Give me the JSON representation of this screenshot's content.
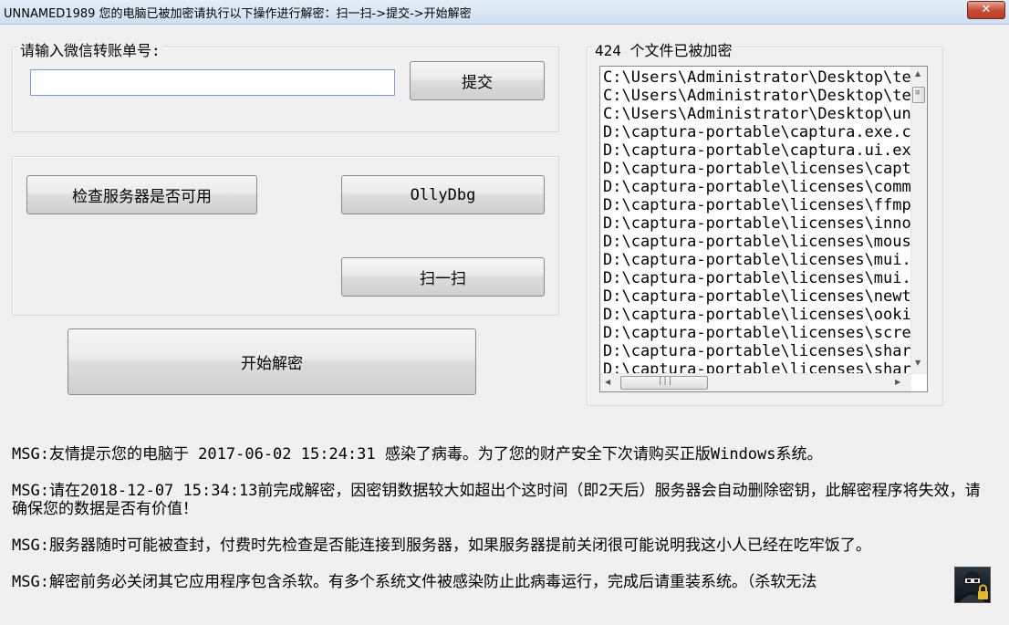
{
  "window": {
    "title": "UNNAMED1989 您的电脑已被加密请执行以下操作进行解密：扫一扫->提交->开始解密",
    "close_label": "✕"
  },
  "transfer": {
    "label": "请输入微信转账单号:",
    "input_value": "",
    "submit_label": "提交"
  },
  "actions": {
    "check_server_label": "检查服务器是否可用",
    "ollydbg_label": "OllyDbg",
    "scan_label": "扫一扫",
    "decrypt_label": "开始解密"
  },
  "files": {
    "label": "424 个文件已被加密",
    "items": [
      "C:\\Users\\Administrator\\Desktop\\te",
      "C:\\Users\\Administrator\\Desktop\\te",
      "C:\\Users\\Administrator\\Desktop\\un",
      "D:\\captura-portable\\captura.exe.co",
      "D:\\captura-portable\\captura.ui.exe",
      "D:\\captura-portable\\licenses\\captu",
      "D:\\captura-portable\\licenses\\comma",
      "D:\\captura-portable\\licenses\\ffmpe",
      "D:\\captura-portable\\licenses\\inno.",
      "D:\\captura-portable\\licenses\\mouse",
      "D:\\captura-portable\\licenses\\mui.c",
      "D:\\captura-portable\\licenses\\mui.t",
      "D:\\captura-portable\\licenses\\newto",
      "D:\\captura-portable\\licenses\\ooki.",
      "D:\\captura-portable\\licenses\\scree",
      "D:\\captura-portable\\licenses\\sharp",
      "D:\\captura-portable\\licenses\\sharp"
    ]
  },
  "messages": [
    "MSG:友情提示您的电脑于 2017-06-02 15:24:31  感染了病毒。为了您的财产安全下次请购买正版Windows系统。",
    "MSG:请在2018-12-07 15:34:13前完成解密，因密钥数据较大如超出个这时间（即2天后）服务器会自动删除密钥，此解密程序将失效，请确保您的数据是否有价值！",
    "MSG:服务器随时可能被查封，付费时先检查是否能连接到服务器，如果服务器提前关闭很可能说明我这小人已经在吃牢饭了。",
    "MSG:解密前务必关闭其它应用程序包含杀软。有多个系统文件被感染防止此病毒运行，完成后请重装系统。（杀软无法"
  ],
  "icons": {
    "lock_avatar": "hacker-lock-icon"
  }
}
